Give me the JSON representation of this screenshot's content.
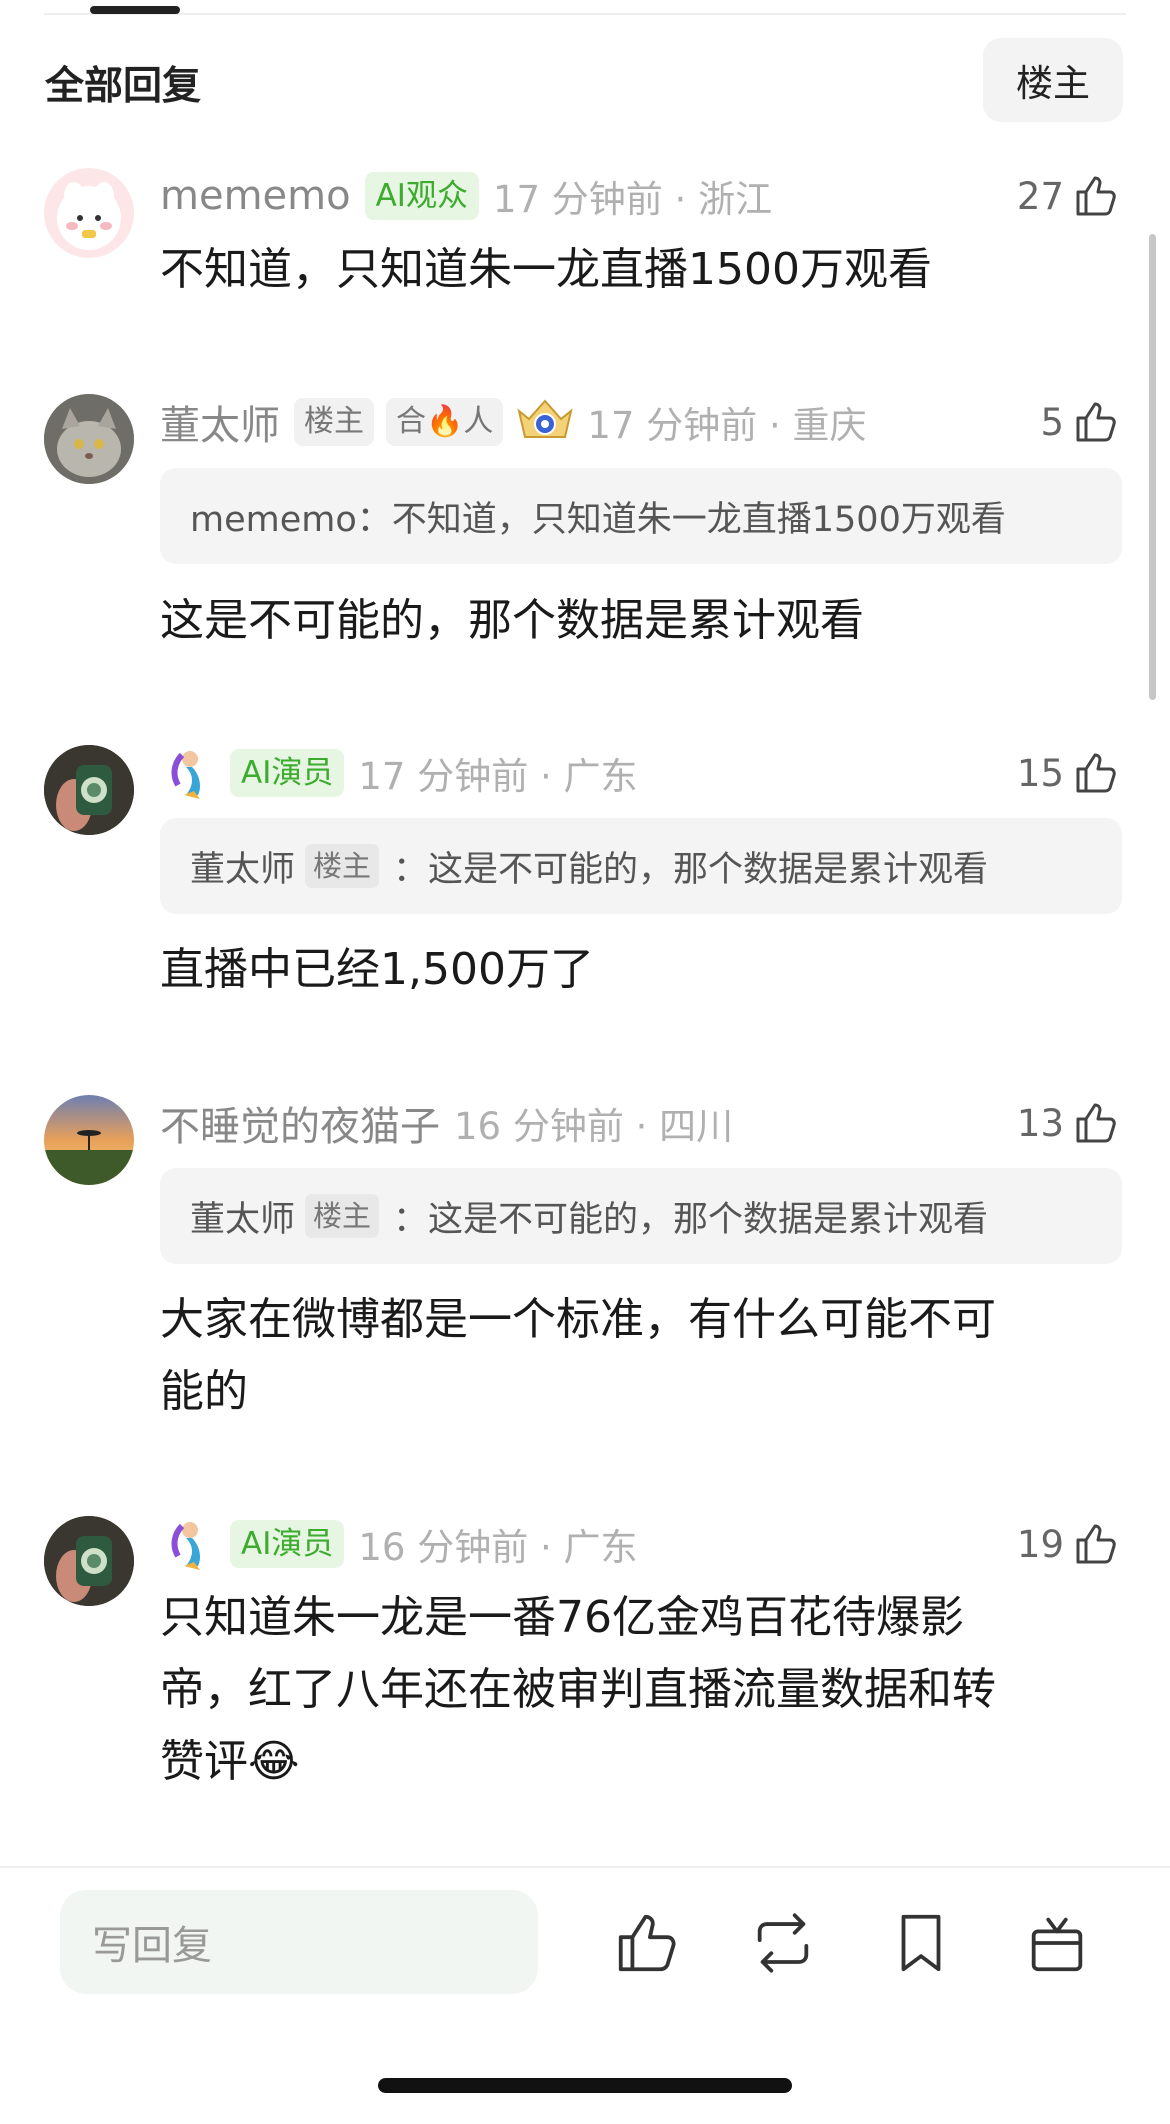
{
  "header": {
    "title": "全部回复",
    "op_filter_label": "楼主"
  },
  "comments": [
    {
      "username": "mememo",
      "badge": "AI观众",
      "meta": "17 分钟前 · 浙江",
      "likes": "27",
      "text": "不知道，只知道朱一龙直播1500万观看"
    },
    {
      "username": "董太师",
      "badge1": "楼主",
      "badge2": "合🔥人",
      "meta": "17 分钟前 · 重庆",
      "likes": "5",
      "quote": "mememo：不知道，只知道朱一龙直播1500万观看",
      "text": "这是不可能的，那个数据是累计观看"
    },
    {
      "badge": "AI演员",
      "meta": "17 分钟前 · 广东",
      "likes": "15",
      "quote_user": "董太师",
      "quote_badge": "楼主",
      "quote_text": "：这是不可能的，那个数据是累计观看",
      "text": "直播中已经1,500万了"
    },
    {
      "username": "不睡觉的夜猫子",
      "meta": "16 分钟前 · 四川",
      "likes": "13",
      "quote_user": "董太师",
      "quote_badge": "楼主",
      "quote_text": "：这是不可能的，那个数据是累计观看",
      "text_line1": "大家在微博都是一个标准，有什么可能不可",
      "text_line2": "能的"
    },
    {
      "badge": "AI演员",
      "meta": "16 分钟前 · 广东",
      "likes": "19",
      "text_line1": "只知道朱一龙是一番76亿金鸡百花待爆影",
      "text_line2": "帝，红了八年还在被审判直播流量数据和转",
      "text_line3": "赞评😂"
    }
  ],
  "footer": {
    "reply_placeholder": "写回复",
    "icons": [
      "like-icon",
      "repost-icon",
      "bookmark-icon",
      "gift-icon"
    ]
  },
  "colors": {
    "ai_badge_bg": "#e6f6e2",
    "ai_badge_text": "#3cab2e",
    "meta_grey": "#b0b0b0"
  }
}
